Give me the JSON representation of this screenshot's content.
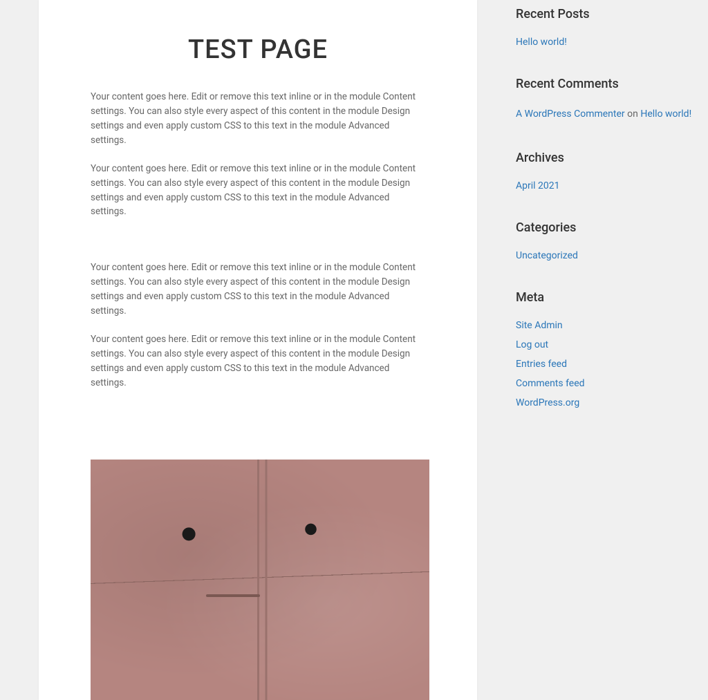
{
  "page": {
    "title": "TEST PAGE",
    "paragraphs": [
      "Your content goes here. Edit or remove this text inline or in the module Content settings. You can also style every aspect of this content in the module Design settings and even apply custom CSS to this text in the module Advanced settings.",
      "Your content goes here. Edit or remove this text inline or in the module Content settings. You can also style every aspect of this content in the module Design settings and even apply custom CSS to this text in the module Advanced settings.",
      "Your content goes here. Edit or remove this text inline or in the module Content settings. You can also style every aspect of this content in the module Design settings and even apply custom CSS to this text in the module Advanced settings.",
      "Your content goes here. Edit or remove this text inline or in the module Content settings. You can also style every aspect of this content in the module Design settings and even apply custom CSS to this text in the module Advanced settings."
    ]
  },
  "sidebar": {
    "recent_posts": {
      "title": "Recent Posts",
      "items": [
        "Hello world!"
      ]
    },
    "recent_comments": {
      "title": "Recent Comments",
      "commenter": "A WordPress Commenter",
      "on_text": " on ",
      "post": "Hello world!"
    },
    "archives": {
      "title": "Archives",
      "items": [
        "April 2021"
      ]
    },
    "categories": {
      "title": "Categories",
      "items": [
        "Uncategorized"
      ]
    },
    "meta": {
      "title": "Meta",
      "items": [
        "Site Admin",
        "Log out",
        "Entries feed",
        "Comments feed",
        "WordPress.org"
      ]
    }
  }
}
